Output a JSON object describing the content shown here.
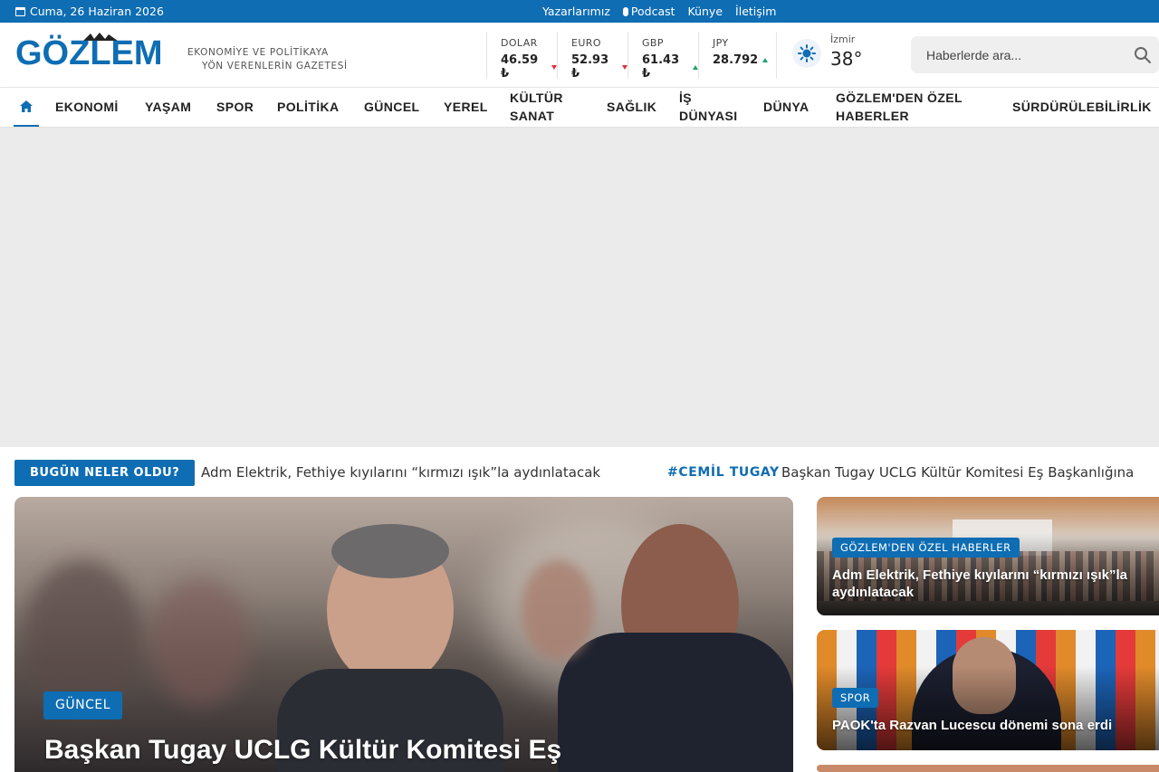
{
  "topbar": {
    "date": "Cuma, 26 Haziran 2026",
    "links": [
      "Yazarlarımız",
      "Podcast",
      "Künye",
      "İletişim"
    ]
  },
  "header": {
    "logo": "GÖZLEM",
    "tagline_line1": "EKONOMİYE VE POLİTİKAYA",
    "tagline_line2": "YÖN VERENLERİN GAZETESİ",
    "rates": [
      {
        "name": "DOLAR",
        "value": "46.59 ₺",
        "trend": "down"
      },
      {
        "name": "EURO",
        "value": "52.93 ₺",
        "trend": "down"
      },
      {
        "name": "GBP",
        "value": "61.43 ₺",
        "trend": "up"
      },
      {
        "name": "JPY",
        "value": "28.792",
        "trend": "up"
      }
    ],
    "weather": {
      "city": "İzmir",
      "temp": "38°",
      "icon": "sun-icon"
    },
    "search": {
      "placeholder": "Haberlerde ara..."
    }
  },
  "nav": {
    "items": [
      {
        "label": "EKONOMİ"
      },
      {
        "label": "YAŞAM"
      },
      {
        "label": "SPOR"
      },
      {
        "label": "POLİTİKA"
      },
      {
        "label": "GÜNCEL"
      },
      {
        "label": "YEREL"
      },
      {
        "label1": "KÜLTÜR",
        "label2": "SANAT"
      },
      {
        "label": "SAĞLIK"
      },
      {
        "label1": "İŞ",
        "label2": "DÜNYASI"
      },
      {
        "label": "DÜNYA"
      },
      {
        "label1": "GÖZLEM'DEN ÖZEL",
        "label2": "HABERLER"
      },
      {
        "label": "SÜRDÜRÜLEBİLİRLİK"
      }
    ]
  },
  "ticker": {
    "label": "BUGÜN NELER OLDU?",
    "item1": "Adm Elektrik, Fethiye kıyılarını “kırmızı ışık”la aydınlatacak",
    "tag": "#CEMİL TUGAY",
    "item2": "Başkan Tugay UCLG Kültür Komitesi Eş Başkanlığına"
  },
  "main_story": {
    "category": "GÜNCEL",
    "title": "Başkan Tugay UCLG Kültür Komitesi Eş"
  },
  "side_stories": [
    {
      "category": "GÖZLEM'DEN ÖZEL HABERLER",
      "title": "Adm Elektrik, Fethiye kıyılarını “kırmızı ışık”la aydınlatacak"
    },
    {
      "category": "SPOR",
      "title": "PAOK'ta Razvan Lucescu dönemi sona erdi"
    }
  ],
  "colors": {
    "brand": "#0e6db3",
    "down": "#e0303a",
    "up": "#1aa36a"
  }
}
